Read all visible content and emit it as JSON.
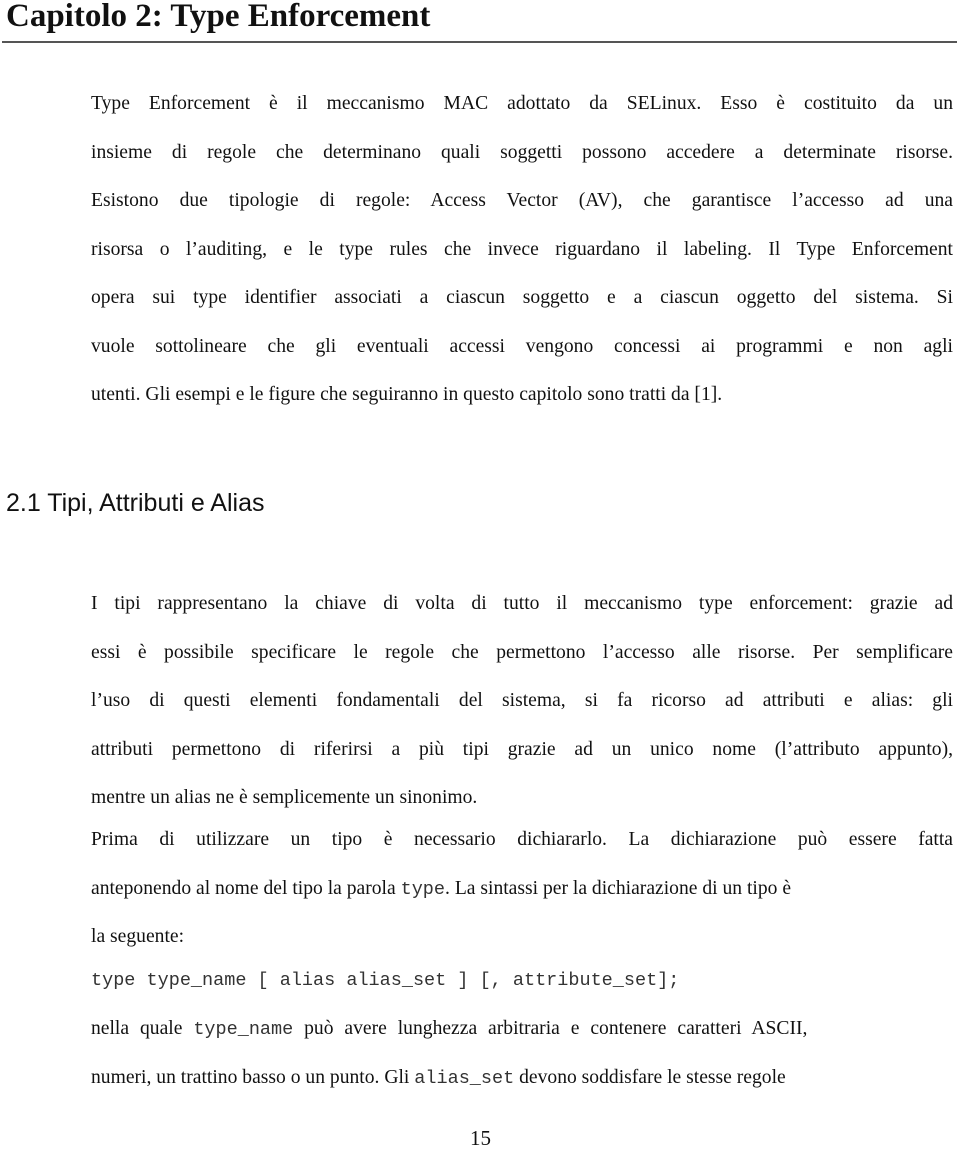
{
  "chapter": {
    "title": "Capitolo 2: Type Enforcement"
  },
  "intro_paragraph": {
    "lines": [
      "Type Enforcement è il meccanismo MAC adottato da SELinux. Esso è costituito da un",
      "insieme di regole che determinano quali soggetti possono accedere a determinate risorse.",
      "Esistono due tipologie di regole: Access Vector (AV), che garantisce l’accesso ad una",
      "risorsa o l’auditing, e le type rules che invece riguardano il labeling.  Il Type Enforcement",
      "opera sui type identifier associati a ciascun soggetto e a ciascun oggetto del sistema. Si",
      "vuole sottolineare che gli eventuali accessi vengono concessi ai programmi e non agli",
      "utenti. Gli esempi e le figure che seguiranno in questo capitolo sono tratti da [1]."
    ]
  },
  "section": {
    "title": "2.1 Tipi, Attributi e Alias"
  },
  "section_paragraph_1": {
    "lines": [
      "I tipi rappresentano la chiave di volta di tutto il meccanismo type enforcement: grazie ad",
      "essi è possibile specificare le regole che permettono l’accesso alle risorse. Per semplificare",
      "l’uso di questi elementi fondamentali del sistema, si fa ricorso ad attributi e alias: gli",
      "attributi permettono di riferirsi a più tipi grazie ad un unico nome (l’attributo appunto),",
      "mentre un alias ne è semplicemente un sinonimo."
    ]
  },
  "section_paragraph_2": {
    "line1": "Prima di utilizzare un tipo è necessario dichiararlo. La dichiarazione può essere fatta",
    "line2_before": "anteponendo al nome del tipo la parola ",
    "line2_code": "type",
    "line2_after": ". La sintassi per la dichiarazione di un tipo è",
    "line3": "la seguente:"
  },
  "code_syntax": "type type_name [ alias alias_set ] [, attribute_set];",
  "section_paragraph_3": {
    "line1_before": "nella quale ",
    "line1_code": "type_name",
    "line1_after": " può avere lunghezza arbitraria e contenere caratteri ASCII,",
    "line2_before": "numeri, un trattino basso o un punto. Gli ",
    "line2_code": "alias_set",
    "line2_after": " devono soddisfare le stesse regole"
  },
  "footer": {
    "page_number": "15"
  }
}
